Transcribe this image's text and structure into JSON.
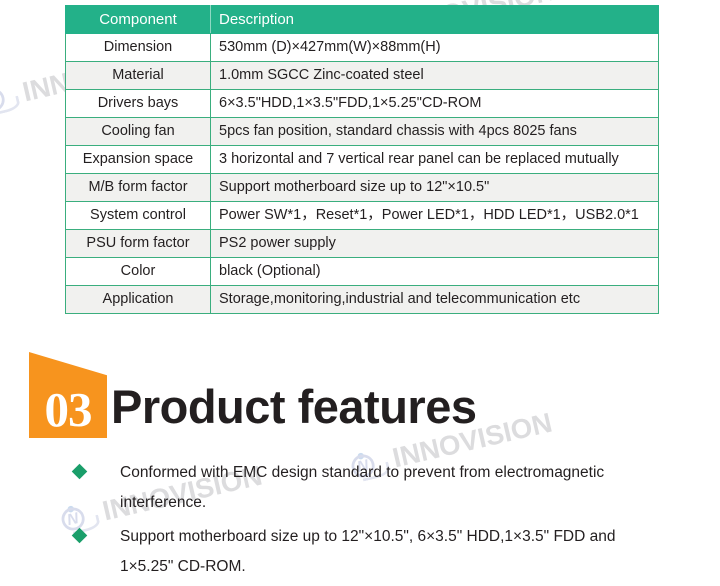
{
  "watermark": {
    "text": "INNOVISION",
    "logo_icon": "innovision-logo-icon"
  },
  "spec_table": {
    "headers": [
      "Component",
      "Description"
    ],
    "rows": [
      [
        "Dimension",
        "530mm (D)×427mm(W)×88mm(H)"
      ],
      [
        "Material",
        "1.0mm SGCC Zinc-coated steel"
      ],
      [
        "Drivers bays",
        "6×3.5\"HDD,1×3.5\"FDD,1×5.25\"CD-ROM"
      ],
      [
        "Cooling fan",
        "5pcs fan position, standard chassis with 4pcs 8025 fans"
      ],
      [
        "Expansion space",
        "3 horizontal and 7 vertical rear panel can be replaced mutually"
      ],
      [
        "M/B form factor",
        "Support motherboard size up to 12\"×10.5\""
      ],
      [
        "System control",
        "Power SW*1，Reset*1，Power LED*1，HDD LED*1，USB2.0*1"
      ],
      [
        "PSU form factor",
        "PS2 power supply"
      ],
      [
        "Color",
        "black (Optional)"
      ],
      [
        "Application",
        "Storage,monitoring,industrial and telecommunication etc"
      ]
    ]
  },
  "section": {
    "number": "03",
    "title": "Product features",
    "accent_color": "#f7941e",
    "header_color": "#23b189",
    "bullet_color": "#1a9e6a"
  },
  "features": [
    "Conformed with EMC design standard to prevent from electromagnetic interference.",
    "Support motherboard size up to 12\"×10.5\", 6×3.5\" HDD,1×3.5\" FDD and 1×5.25\" CD-ROM."
  ]
}
